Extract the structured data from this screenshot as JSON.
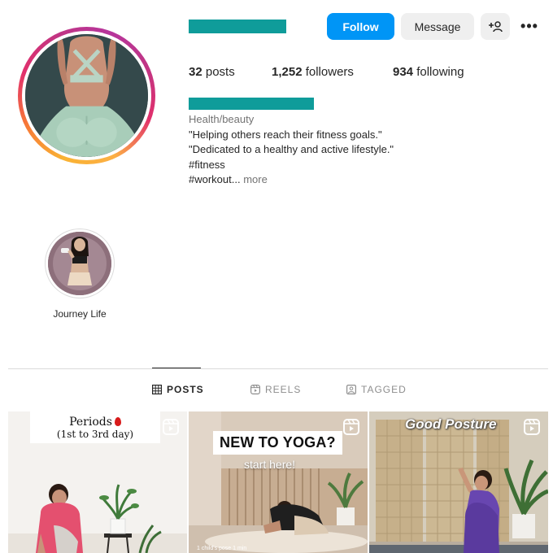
{
  "profile": {
    "follow_label": "Follow",
    "message_label": "Message",
    "suggest_icon": "add-person-icon",
    "more_icon": "more-options-icon",
    "more_glyph": "•••",
    "stats": {
      "posts_count": "32",
      "posts_label": "posts",
      "followers_count": "1,252",
      "followers_label": "followers",
      "following_count": "934",
      "following_label": "following"
    },
    "bio": {
      "category": "Health/beauty",
      "line1": "\"Helping others reach their fitness goals.\"",
      "line2": "\"Dedicated to a healthy and active lifestyle.\"",
      "line3": "#fitness",
      "line4": "#workout...",
      "more": "more"
    }
  },
  "highlights": [
    {
      "label": "Journey Life"
    }
  ],
  "tabs": [
    {
      "label": "POSTS",
      "icon": "grid-icon",
      "active": true
    },
    {
      "label": "REELS",
      "icon": "reels-icon",
      "active": false
    },
    {
      "label": "TAGGED",
      "icon": "tagged-icon",
      "active": false
    }
  ],
  "posts": [
    {
      "caption_line1": "Periods",
      "caption_line2": "(1st to 3rd day)",
      "is_reel": true
    },
    {
      "title": "NEW TO YOGA?",
      "subtitle": "start here!",
      "footer": "1 child's pose 1 min",
      "is_reel": true
    },
    {
      "title": "Good Posture",
      "is_reel": true
    }
  ],
  "colors": {
    "accent_blue": "#0095f6",
    "redaction_teal": "#0f9c9a",
    "text_primary": "#262626",
    "text_secondary": "#737373",
    "divider": "#dbdbdb"
  }
}
